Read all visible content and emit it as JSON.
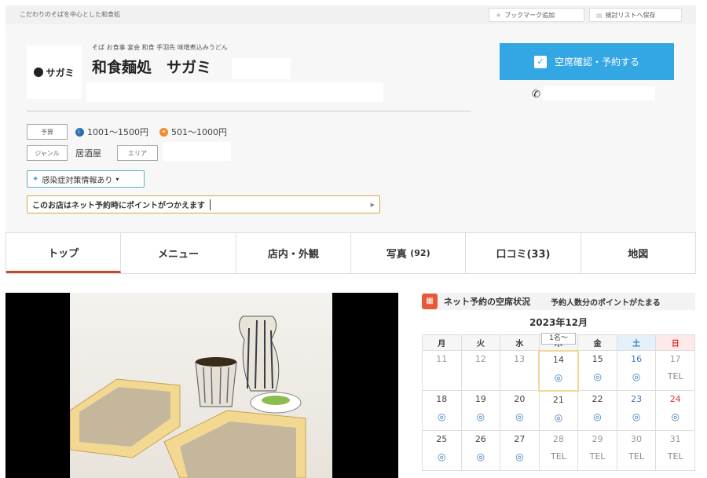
{
  "header": {
    "tagline": "こだわりのそばを中心とした和食処",
    "bookmark_label": "ブックマーク追加",
    "save_list_label": "検討リストへ保存"
  },
  "shop": {
    "logo_text": "サガミ",
    "categories": "そば お食事 宴会 和食 手羽先 味噌煮込みうどん",
    "name": "和食麺処　サガミ",
    "reserve_label": "空席確認・予約する"
  },
  "info": {
    "budget_label": "予算",
    "dinner_price": "1001〜1500円",
    "lunch_price": "501〜1000円",
    "genre_label": "ジャンル",
    "genre_value": "居酒屋",
    "area_label": "エリア",
    "infection_label": "感染症対策情報あり",
    "point_text": "このお店はネット予約時にポイントがつかえます"
  },
  "tabs": [
    {
      "label": "トップ"
    },
    {
      "label": "メニュー"
    },
    {
      "label": "店内・外観"
    },
    {
      "label": "写真",
      "count": "(92)"
    },
    {
      "label": "口コミ(33)"
    },
    {
      "label": "地図"
    }
  ],
  "availability": {
    "title": "ネット予約の空席状況",
    "note": "予約人数分のポイントがたまる",
    "month": "2023年12月",
    "tooltip": "1名〜",
    "weekdays": [
      "月",
      "火",
      "水",
      "木",
      "金",
      "土",
      "日"
    ],
    "weeks": [
      [
        {
          "d": "11",
          "s": "",
          "c": "gray"
        },
        {
          "d": "12",
          "s": "",
          "c": "gray"
        },
        {
          "d": "13",
          "s": "",
          "c": "gray"
        },
        {
          "d": "14",
          "s": "◎",
          "c": "today"
        },
        {
          "d": "15",
          "s": "◎",
          "c": ""
        },
        {
          "d": "16",
          "s": "◎",
          "c": "sat gray"
        },
        {
          "d": "17",
          "s": "TEL",
          "c": "gray tel"
        }
      ],
      [
        {
          "d": "18",
          "s": "◎",
          "c": ""
        },
        {
          "d": "19",
          "s": "◎",
          "c": ""
        },
        {
          "d": "20",
          "s": "◎",
          "c": ""
        },
        {
          "d": "21",
          "s": "◎",
          "c": ""
        },
        {
          "d": "22",
          "s": "◎",
          "c": ""
        },
        {
          "d": "23",
          "s": "◎",
          "c": "sat"
        },
        {
          "d": "24",
          "s": "◎",
          "c": "sun"
        }
      ],
      [
        {
          "d": "25",
          "s": "◎",
          "c": ""
        },
        {
          "d": "26",
          "s": "◎",
          "c": ""
        },
        {
          "d": "27",
          "s": "◎",
          "c": ""
        },
        {
          "d": "28",
          "s": "TEL",
          "c": "gray tel"
        },
        {
          "d": "29",
          "s": "TEL",
          "c": "gray tel"
        },
        {
          "d": "30",
          "s": "TEL",
          "c": "gray tel"
        },
        {
          "d": "31",
          "s": "TEL",
          "c": "gray tel"
        }
      ]
    ]
  }
}
